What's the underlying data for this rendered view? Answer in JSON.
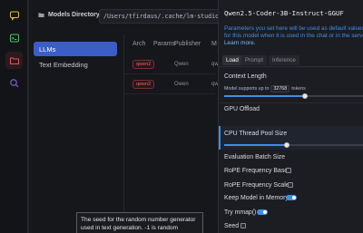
{
  "topbar": {
    "directory_label": "Models Directory",
    "directory_path": "/Users/tfirdaus/.cache/lm-studio/model"
  },
  "sidebar": {
    "items": [
      {
        "label": "LLMs",
        "active": true
      },
      {
        "label": "Text Embedding",
        "active": false
      }
    ]
  },
  "table": {
    "headers": [
      "Arch",
      "Params",
      "Publisher",
      "M"
    ],
    "rows": [
      {
        "arch": "qwen2",
        "publisher": "Qwen",
        "model": "qw"
      },
      {
        "arch": "qwen2",
        "publisher": "Owen",
        "model": "qw"
      }
    ]
  },
  "tooltip": {
    "text": "The seed for the random number generator used in text generation. -1 is random"
  },
  "panel": {
    "model_name": "Qwen2.5-Coder-3B-Instruct-GGUF",
    "info": "Parameters you set here will be used as default values for this model when it is used in the chat or in the server.",
    "learn_more": "Learn more.",
    "tabs": [
      {
        "label": "Load",
        "active": true
      },
      {
        "label": "Prompt",
        "active": false
      },
      {
        "label": "Inference",
        "active": false
      }
    ],
    "context_length": {
      "label": "Context Length",
      "note_prefix": "Model supports up to",
      "max_value": "32768",
      "note_suffix": "tokens",
      "slider_fraction": 0.58
    },
    "gpu_offload": {
      "label": "GPU Offload"
    },
    "cpu_thread_pool": {
      "label": "CPU Thread Pool Size",
      "slider_fraction": 0.45
    },
    "eval_batch": {
      "label": "Evaluation Batch Size"
    },
    "rope_base": {
      "label": "RoPE Frequency Base",
      "checked": false
    },
    "rope_scale": {
      "label": "RoPE Frequency Scale",
      "checked": false
    },
    "keep_in_memory": {
      "label": "Keep Model in Memory",
      "on": true
    },
    "try_mmap": {
      "label": "Try mmap()",
      "on": true
    },
    "seed": {
      "label": "Seed",
      "checked": false
    }
  },
  "colors": {
    "accent": "#3f8ee8",
    "selection": "#3a5ec6",
    "danger": "#e06a6a"
  },
  "icons": {
    "rail": [
      "chat-icon",
      "terminal-icon",
      "folder-icon",
      "search-icon"
    ],
    "directory": "folder-icon"
  }
}
